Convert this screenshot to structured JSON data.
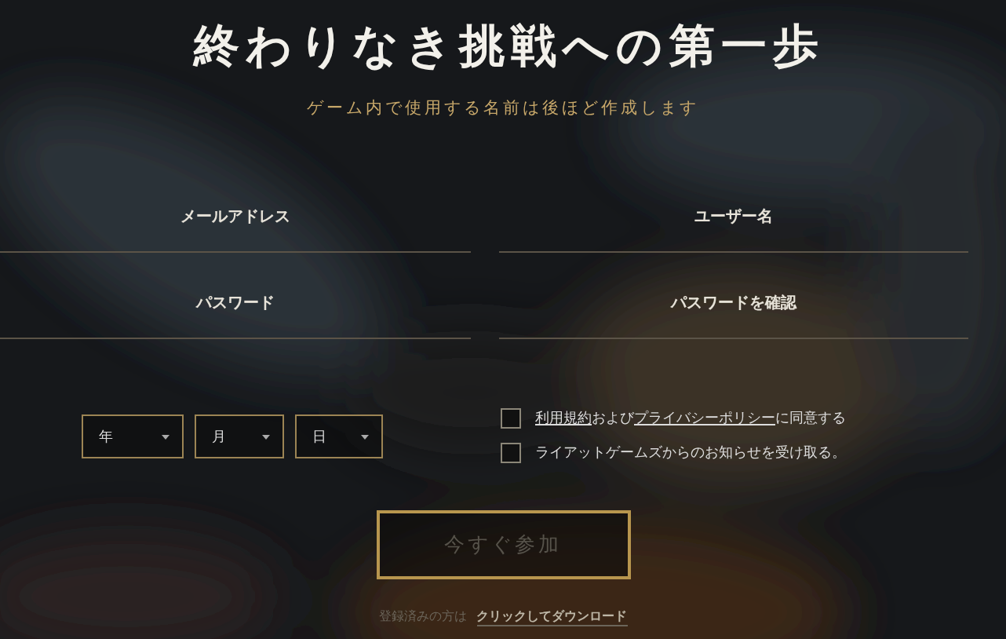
{
  "title": "終わりなき挑戦への第一歩",
  "subtitle": "ゲーム内で使用する名前は後ほど作成します",
  "fields": [
    {
      "placeholder": "メールアドレス"
    },
    {
      "placeholder": "ユーザー名"
    },
    {
      "placeholder": "パスワード"
    },
    {
      "placeholder": "パスワードを確認"
    }
  ],
  "birthdate": [
    {
      "placeholder": "年"
    },
    {
      "placeholder": "月"
    },
    {
      "placeholder": "日"
    }
  ],
  "checkboxes": [
    {
      "checked": false,
      "parts": [
        {
          "kind": "link",
          "text": "利用規約"
        },
        {
          "kind": "text",
          "text": "および"
        },
        {
          "kind": "link",
          "text": "プライバシーポリシー"
        },
        {
          "kind": "text",
          "text": "に同意する"
        }
      ]
    },
    {
      "checked": false,
      "parts": [
        {
          "kind": "text",
          "text": "ライアットゲームズからのお知らせを受け取る。"
        }
      ]
    }
  ],
  "submit": {
    "label": "今すぐ参加",
    "disabled": true
  },
  "footer": {
    "text": "登録済みの方は",
    "link": "クリックしてダウンロード"
  }
}
